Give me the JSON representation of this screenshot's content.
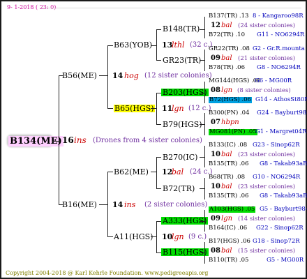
{
  "header": {
    "date": "9- 1-2018 ( 23: 0)",
    "date_color": "#cc0099"
  },
  "colors": {
    "tree_text": "#000000",
    "lines": "#222222",
    "italic_red": "#cc0000",
    "purple": "#7030a0",
    "blue": "#0000bb",
    "green_hl": "#00dd00",
    "yellow_hl": "#ffff00",
    "cyan_hl": "#00a0e0",
    "root_bg": "#ffd0ff",
    "footer": "#808000"
  },
  "root": {
    "code": "B134(ME)",
    "count": "16",
    "breed": "ins",
    "info": "(Drones from 4 sister colonies)"
  },
  "gen1": [
    {
      "code": "B56(ME)",
      "count": "14",
      "breed": "hog",
      "info": "(12 sister colonies)"
    },
    {
      "code": "B16(ME)",
      "count": "14",
      "breed": "ins",
      "info": "(2 sister colonies)"
    }
  ],
  "gen2": [
    {
      "code": "B63(YOB)",
      "count": "13",
      "breed": "lthl",
      "info": "(32 c.)"
    },
    {
      "code": "B65(HGS)",
      "count": "11",
      "breed": "lgn",
      "info": "(12 c.)"
    },
    {
      "code": "B62(ME)",
      "count": "12",
      "breed": "bal",
      "info": "(24 c.)"
    },
    {
      "code": "A11(HGS)",
      "count": "10",
      "breed": "lgn",
      "info": "(9 c.)"
    }
  ],
  "gen3": [
    "B148(TR)",
    "GR23(TR)",
    "B203(HGS)",
    "B79(HGS)",
    "B270(IC)",
    "B72(TR)",
    "A333(HGS)",
    "B115(HGS)"
  ],
  "gen4": [
    {
      "top": "B137(TR) .13",
      "top_blue": "8 - Kangaroo98R",
      "count": "12",
      "breed": "bal",
      "info": "(24 sister colonies)",
      "bottom": "B72(TR) .10",
      "bottom_blue": "G11 - NO6294R"
    },
    {
      "top": "GR22(TR) .08",
      "top_blue": "G2 - Gr.R.mounta",
      "count": "09",
      "breed": "bal",
      "info": "(21 sister colonies)",
      "bottom": "B78(TR) .06",
      "bottom_blue": "G8 - NO6294R"
    },
    {
      "top": "MG144(HGS) .06",
      "top_blue": "G6 - MG00R",
      "count": "08",
      "breed": "lgn",
      "info": "(8 sister colonies)",
      "bottom": "B72(HGS) .06",
      "bottom_blue": "G14 - AthosSt80R"
    },
    {
      "top": "B300(PN) .04",
      "top_blue": "G24 - Bayburt98-3",
      "count": "07",
      "breed": "hbpn",
      "info": "",
      "bottom": "MG081(PN) .05",
      "bottom_blue": "G1 - Margret04R"
    },
    {
      "top": "B133(IC) .08",
      "top_blue": "G23 - Sinop62R",
      "count": "10",
      "breed": "bal",
      "info": "(23 sister colonies)",
      "bottom": "B135(TR) .06",
      "bottom_blue": "G8 - Takab93aR"
    },
    {
      "top": "B68(TR) .08",
      "top_blue": "G10 - NO6294R",
      "count": "10",
      "breed": "bal",
      "info": "(23 sister colonies)",
      "bottom": "B135(TR) .06",
      "bottom_blue": "G8 - Takab93aR"
    },
    {
      "top": "A103(HGS) .05",
      "top_blue": "G5 - Bayburt98-3",
      "count": "09",
      "breed": "lgn",
      "info": "(14 sister colonies)",
      "bottom": "B164(IC) .06",
      "bottom_blue": "G22 - Sinop62R"
    },
    {
      "top": "B17(HGS) .06",
      "top_blue": "G18 - Sinop72R",
      "count": "08",
      "breed": "bal",
      "info": "(15 sister colonies)",
      "bottom": "B110(TR) .05",
      "bottom_blue": "G5 - MG00R"
    }
  ],
  "footer": "Copyright 2004-2018 @ Karl Kehrle Foundation.   www.pedigreeapis.org"
}
